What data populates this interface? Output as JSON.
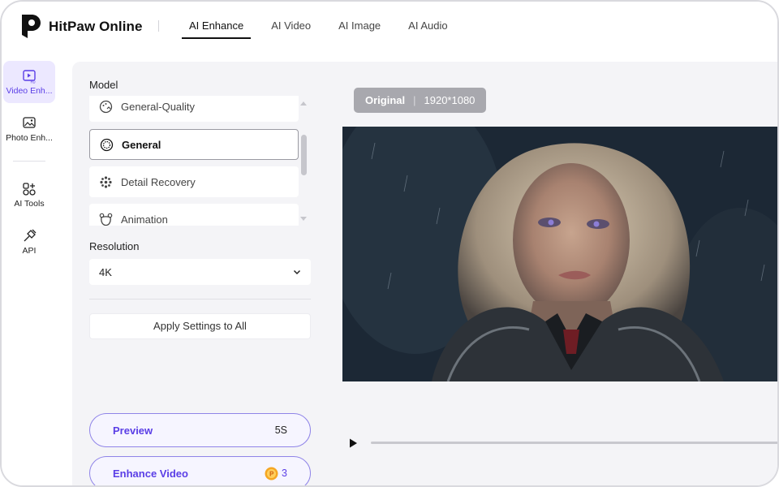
{
  "app": {
    "brand": "HitPaw Online",
    "nav_tabs": [
      {
        "label": "AI Enhance",
        "active": true
      },
      {
        "label": "AI Video"
      },
      {
        "label": "AI Image"
      },
      {
        "label": "AI Audio"
      }
    ]
  },
  "sidebar": {
    "items": [
      {
        "label": "Video Enh...",
        "icon": "video-hd-icon",
        "active": true
      },
      {
        "label": "Photo Enh...",
        "icon": "photo-hd-icon"
      },
      {
        "label": "AI Tools",
        "icon": "ai-tools-icon"
      },
      {
        "label": "API",
        "icon": "api-plug-icon"
      }
    ]
  },
  "settings": {
    "model_label": "Model",
    "models": [
      {
        "label": "General-Quality",
        "icon": "quality-palette-icon"
      },
      {
        "label": "General",
        "icon": "general-target-icon",
        "selected": true
      },
      {
        "label": "Detail Recovery",
        "icon": "detail-dots-icon"
      },
      {
        "label": "Animation",
        "icon": "animation-bear-icon"
      }
    ],
    "resolution_label": "Resolution",
    "resolution_value": "4K",
    "apply_label": "Apply Settings to All",
    "preview_label": "Preview",
    "preview_meta": "5S",
    "enhance_label": "Enhance Video",
    "enhance_credits": "3"
  },
  "preview": {
    "badge_title": "Original",
    "badge_resolution": "1920*1080",
    "playback_progress": 0
  },
  "colors": {
    "accent": "#5a3ee6",
    "accent_soft": "#ece8ff",
    "panel_bg": "#f4f4f7",
    "badge_bg": "#a8a8ae"
  }
}
